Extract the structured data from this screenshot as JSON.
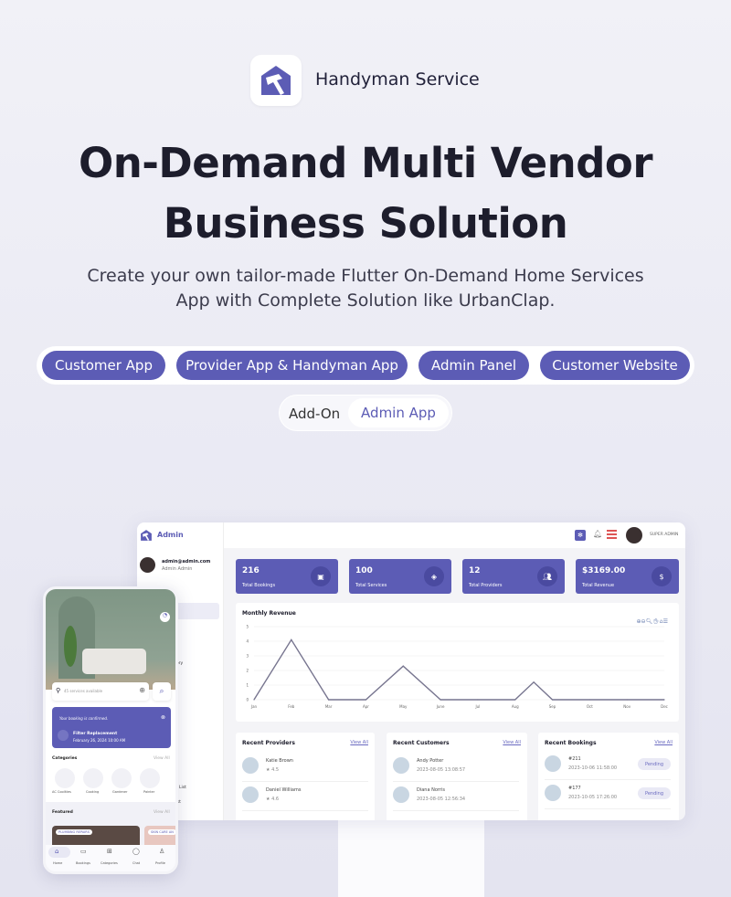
{
  "brand": {
    "name": "Handyman Service",
    "logo_icon": "house-hammer-icon",
    "accent": "#5c5cb5"
  },
  "hero": {
    "title_line1": "On-Demand Multi Vendor",
    "title_line2": "Business Solution",
    "subtitle_line1": "Create your own tailor-made Flutter On-Demand Home Services",
    "subtitle_line2": "App with Complete Solution like UrbanClap."
  },
  "products": [
    "Customer App",
    "Provider App & Handyman App",
    "Admin Panel",
    "Customer Website"
  ],
  "addon": {
    "label": "Add-On",
    "item": "Admin App"
  },
  "admin": {
    "logo_text": "Admin",
    "user_role": "SUPER ADMIN",
    "email": "admin@admin.com",
    "name": "Admin Admin",
    "sidebar_fragments": [
      "rd",
      "gory",
      "n",
      "er List",
      "List"
    ],
    "stats": [
      {
        "value": "216",
        "label": "Total Bookings",
        "icon": "calendar-icon"
      },
      {
        "value": "100",
        "label": "Total Services",
        "icon": "tag-icon"
      },
      {
        "value": "12",
        "label": "Total Providers",
        "icon": "users-icon"
      },
      {
        "value": "$3169.00",
        "label": "Total Revenue",
        "icon": "dollar-icon"
      }
    ],
    "recent_providers": {
      "title": "Recent Providers",
      "view_all": "View All",
      "rows": [
        {
          "name": "Katie Brown",
          "rating": "★ 4.5"
        },
        {
          "name": "Daniel Williams",
          "rating": "★ 4.6"
        }
      ]
    },
    "recent_customers": {
      "title": "Recent Customers",
      "view_all": "View All",
      "rows": [
        {
          "name": "Andy Potter",
          "date": "2023-08-05 13:08:57"
        },
        {
          "name": "Diana Norris",
          "date": "2023-08-05 12:56:34"
        }
      ]
    },
    "recent_bookings": {
      "title": "Recent Bookings",
      "view_all": "View All",
      "rows": [
        {
          "id": "#211",
          "date": "2023-10-06 11:58:00",
          "status": "Pending"
        },
        {
          "id": "#177",
          "date": "2023-10-05 17:26:00",
          "status": "Pending"
        }
      ]
    }
  },
  "chart_data": {
    "type": "line",
    "title": "Monthly Revenue",
    "categories": [
      "Jan",
      "Feb",
      "Mar",
      "Apr",
      "May",
      "June",
      "Jul",
      "Aug",
      "Sep",
      "Oct",
      "Nov",
      "Dec"
    ],
    "points": [
      {
        "x": 1,
        "y": 0
      },
      {
        "x": 2,
        "y": 4.1
      },
      {
        "x": 3,
        "y": 0
      },
      {
        "x": 4,
        "y": 0
      },
      {
        "x": 5,
        "y": 2.3
      },
      {
        "x": 6,
        "y": 0
      },
      {
        "x": 7,
        "y": 0
      },
      {
        "x": 8,
        "y": 0
      },
      {
        "x": 8.5,
        "y": 1.2
      },
      {
        "x": 9,
        "y": 0
      },
      {
        "x": 10,
        "y": 0
      },
      {
        "x": 11,
        "y": 0
      },
      {
        "x": 12,
        "y": 0
      }
    ],
    "ylim": [
      0,
      5
    ],
    "yticks": [
      "0",
      "1",
      "2",
      "3",
      "4",
      "5"
    ],
    "grid": true,
    "line_color": "#77758f"
  },
  "phone": {
    "search_placeholder": "45 services available",
    "banner_title": "Your booking is confirmed.",
    "banner_service": "Filter Replacement",
    "banner_date": "February 26, 2024 10:00 AM",
    "categories_title": "Categories",
    "view_all": "View All",
    "categories": [
      "AC Coolities",
      "Cooking",
      "Gardener",
      "Painter"
    ],
    "featured_title": "Featured",
    "featured_tags": [
      "PLUMBING REPAIRS",
      "SKIN CARE AN"
    ],
    "nav": [
      "Home",
      "Bookings",
      "Categories",
      "Chat",
      "Profile"
    ]
  }
}
